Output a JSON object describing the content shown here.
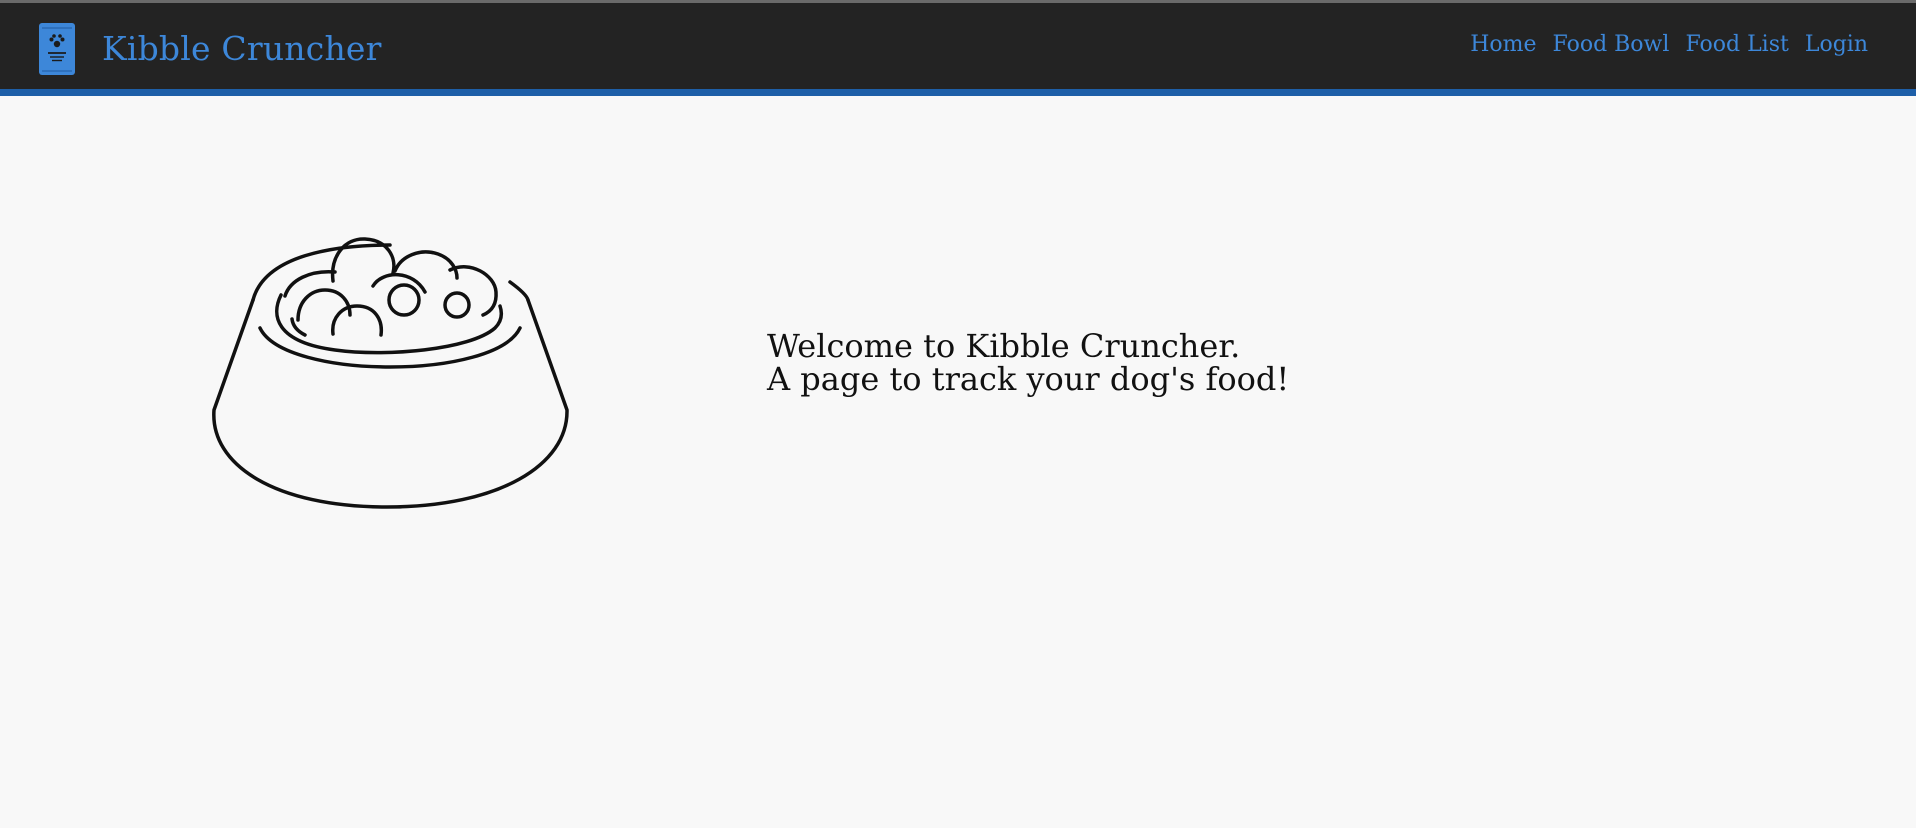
{
  "navbar": {
    "brand": {
      "icon": "dog-food-bag-icon",
      "title": "Kibble Cruncher"
    },
    "links": [
      {
        "label": "Home"
      },
      {
        "label": "Food Bowl"
      },
      {
        "label": "Food List"
      },
      {
        "label": "Login"
      }
    ]
  },
  "main": {
    "illustration": "dog-food-bowl-icon",
    "welcome": {
      "line1": "Welcome to Kibble Cruncher.",
      "line2": "A page to track your dog's food!"
    }
  },
  "colors": {
    "navbar_bg": "#232323",
    "accent": "#3d87d9",
    "accent_bar": "#1e5fa8",
    "page_bg": "#f8f8f8",
    "text": "#111111"
  }
}
